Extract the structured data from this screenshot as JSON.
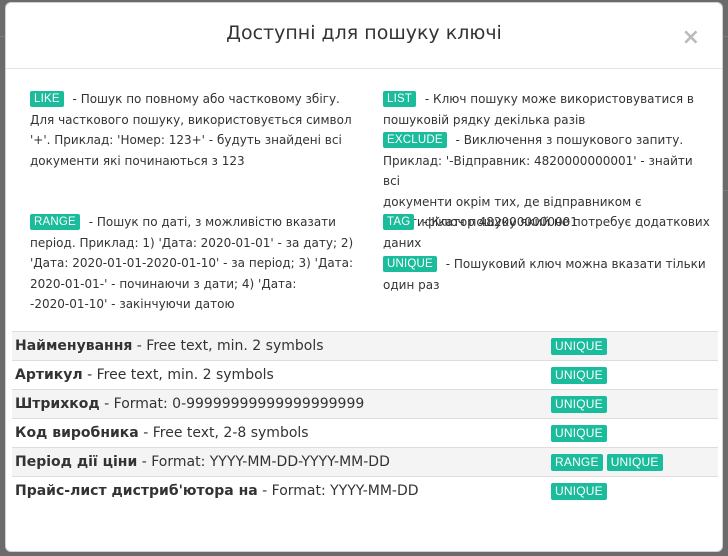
{
  "modal": {
    "title": "Доступні для пошуку ключі",
    "close_label": "×"
  },
  "legend": [
    {
      "tag": "LIKE",
      "lines": [
        " - Пошук по повному або частковому збігу.",
        "Для часткового пошуку, використовується символ",
        "'+'. Приклад: 'Номер: 123+' - будуть знайдені всі",
        "документи які починаються з 123"
      ]
    },
    {
      "tag": "LIST",
      "lines": [
        " - Ключ пошуку може використовуватися в",
        "пошуковій рядку декілька разів"
      ]
    },
    {
      "tag": "EXCLUDE",
      "lines": [
        " - Виключення з пошукового запиту.",
        "Приклад: '-Відправник: 4820000000001' - знайти всі",
        "документи окрім тих, де відправником є",
        "ідентифікатор 4820000000001"
      ]
    },
    {
      "tag": "RANGE",
      "lines": [
        " - Пошук по даті, з можливістю вказати",
        "період. Приклад: 1) 'Дата: 2020-01-01' - за дату; 2)",
        "'Дата: 2020-01-01-2020-01-10' - за період; 3) 'Дата:",
        "2020-01-01-' - починаючи з дати; 4) 'Дата:",
        "-2020-01-10' - закінчуючи датою"
      ]
    },
    {
      "tag": "TAG",
      "lines": [
        " - Ключ пошуку який не потребує додаткових",
        "даних"
      ]
    },
    {
      "tag": "UNIQUE",
      "lines": [
        " - Пошуковий ключ можна вказати тільки",
        "один раз"
      ]
    }
  ],
  "keys": [
    {
      "name": "Найменування",
      "desc": " - Free text, min. 2 symbols",
      "tags": [
        "UNIQUE"
      ]
    },
    {
      "name": "Артикул",
      "desc": " - Free text, min. 2 symbols",
      "tags": [
        "UNIQUE"
      ]
    },
    {
      "name": "Штрихкод",
      "desc": " - Format: 0-99999999999999999999",
      "tags": [
        "UNIQUE"
      ]
    },
    {
      "name": "Код виробника",
      "desc": " - Free text, 2-8 symbols",
      "tags": [
        "UNIQUE"
      ]
    },
    {
      "name": "Період дії ціни",
      "desc": " - Format: YYYY-MM-DD-YYYY-MM-DD",
      "tags": [
        "RANGE",
        "UNIQUE"
      ]
    },
    {
      "name": "Прайс-лист дистриб'ютора на",
      "desc": " - Format: YYYY-MM-DD",
      "tags": [
        "UNIQUE"
      ]
    }
  ],
  "colors": {
    "badge": "#1abc9c",
    "overlay": "#6b6b6b"
  }
}
